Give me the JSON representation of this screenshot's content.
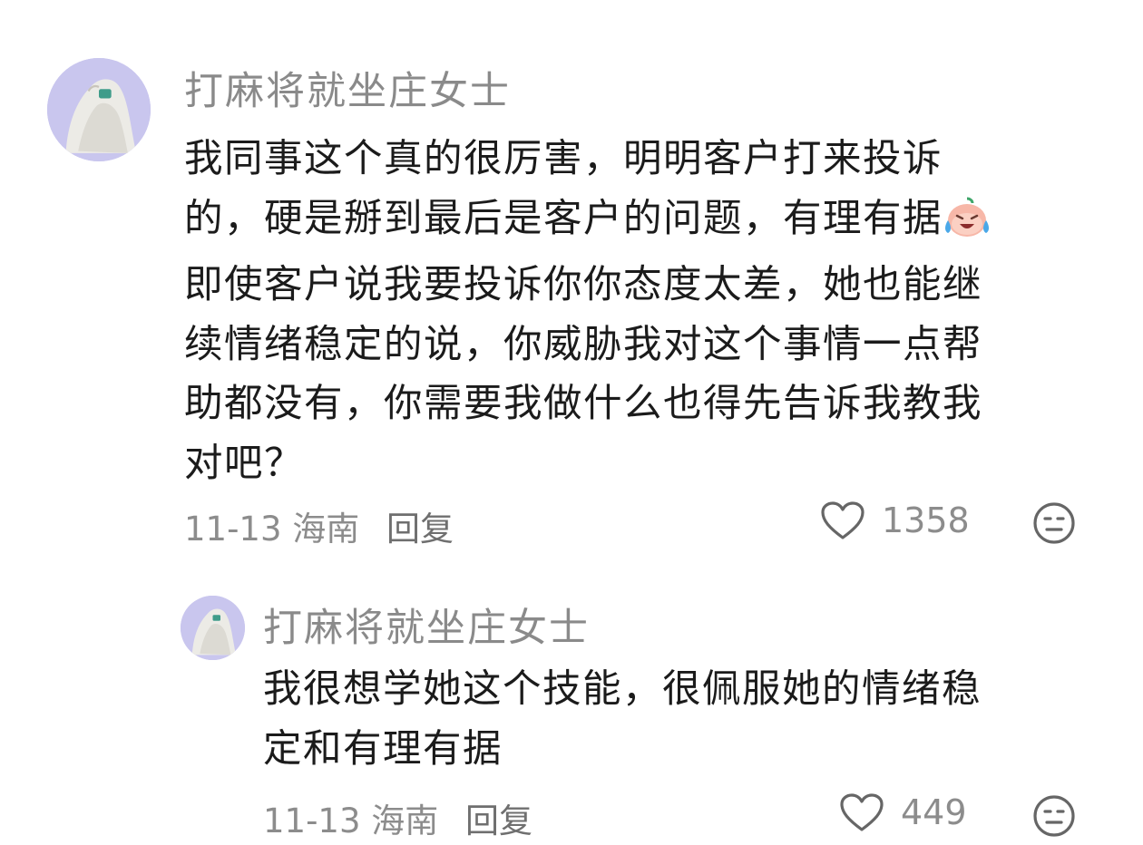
{
  "comments": [
    {
      "username": "打麻将就坐庄女士",
      "lines": [
        "我同事这个真的很厉害，明明客户打来投诉",
        "的，硬是掰到最后是客户的问题，有理有据",
        "即使客户说我要投诉你你态度太差，她也能继",
        "续情绪稳定的说，你威胁我对这个事情一点帮",
        "助都没有，你需要我做什么也得先告诉我教我",
        "对吧？"
      ],
      "emoji": "crying-laughing-emoji",
      "date": "11-13",
      "location": "海南",
      "reply_label": "回复",
      "like_count": "1358"
    },
    {
      "username": "打麻将就坐庄女士",
      "lines": [
        "我很想学她这个技能，很佩服她的情绪稳",
        "定和有理有据"
      ],
      "date": "11-13",
      "location": "海南",
      "reply_label": "回复",
      "like_count": "449"
    }
  ],
  "icons": {
    "like": "heart-outline-icon",
    "dislike": "meh-face-icon"
  },
  "colors": {
    "avatar_bg": "#c9c6ee",
    "meta_text": "#8c8c8c",
    "username": "#8a8a8a"
  }
}
